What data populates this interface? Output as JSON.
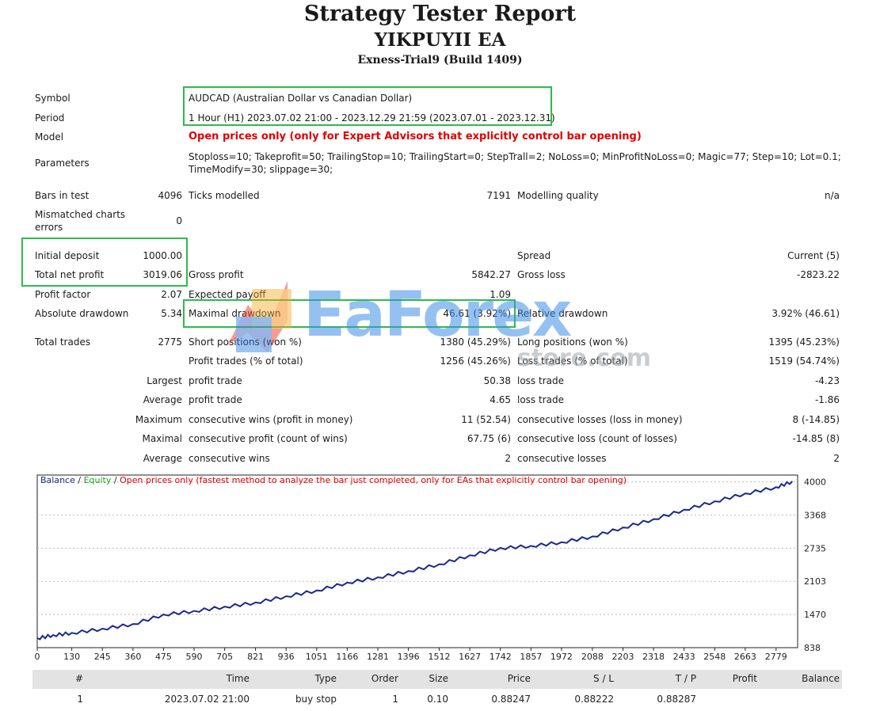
{
  "header": {
    "title": "Strategy Tester Report",
    "ea_name": "YIKPUYII EA",
    "server": "Exness-Trial9 (Build 1409)"
  },
  "settings": {
    "symbol_label": "Symbol",
    "symbol_value": "AUDCAD (Australian Dollar vs Canadian Dollar)",
    "period_label": "Period",
    "period_value": "1 Hour (H1) 2023.07.02 21:00 - 2023.12.29 21:59 (2023.07.01 - 2023.12.31)",
    "model_label": "Model",
    "model_value": "Open prices only (only for Expert Advisors that explicitly control bar opening)",
    "parameters_label": "Parameters",
    "parameters_line1": "Stoploss=10; Takeprofit=50; TrailingStop=10; TrailingStart=0; StepTrall=2; NoLoss=0; MinProfitNoLoss=0; Magic=77; Step=10; Lot=0.1;",
    "parameters_line2": "TimeModify=30; slippage=30;"
  },
  "stats": {
    "bars_label": "Bars in test",
    "bars_value": "4096",
    "ticks_label": "Ticks modelled",
    "ticks_value": "7191",
    "quality_label": "Modelling quality",
    "quality_value": "n/a",
    "mismatch_label1": "Mismatched charts",
    "mismatch_label2": "errors",
    "mismatch_value": "0",
    "initial_label": "Initial deposit",
    "initial_value": "1000.00",
    "spread_label": "Spread",
    "spread_value": "Current (5)",
    "netprofit_label": "Total net profit",
    "netprofit_value": "3019.06",
    "grossprofit_label": "Gross profit",
    "grossprofit_value": "5842.27",
    "grossloss_label": "Gross loss",
    "grossloss_value": "-2823.22",
    "pf_label": "Profit factor",
    "pf_value": "2.07",
    "expected_label": "Expected payoff",
    "expected_value": "1.09",
    "absdd_label": "Absolute drawdown",
    "absdd_value": "5.34",
    "maxdd_label": "Maximal drawdown",
    "maxdd_value": "46.61 (3.92%)",
    "reldd_label": "Relative drawdown",
    "reldd_value": "3.92% (46.61)",
    "total_label": "Total trades",
    "total_value": "2775",
    "short_label": "Short positions (won %)",
    "short_value": "1380 (45.29%)",
    "long_label": "Long positions (won %)",
    "long_value": "1395 (45.23%)",
    "ptrades_label": "Profit trades (% of total)",
    "ptrades_value": "1256 (45.26%)",
    "ltrades_label": "Loss trades (% of total)",
    "ltrades_value": "1519 (54.74%)",
    "largest_label": "Largest",
    "largest_p_label": "profit trade",
    "largest_p_value": "50.38",
    "largest_l_label": "loss trade",
    "largest_l_value": "-4.23",
    "average_label": "Average",
    "average_p_label": "profit trade",
    "average_p_value": "4.65",
    "average_l_label": "loss trade",
    "average_l_value": "-1.86",
    "maximum_label": "Maximum",
    "maximum_w_label": "consecutive wins (profit in money)",
    "maximum_w_value": "11 (52.54)",
    "maximum_l_label": "consecutive losses (loss in money)",
    "maximum_l_value": "8 (-14.85)",
    "maximal_label": "Maximal",
    "maximal_w_label": "consecutive profit (count of wins)",
    "maximal_w_value": "67.75 (6)",
    "maximal_l_label": "consecutive loss (count of losses)",
    "maximal_l_value": "-14.85 (8)",
    "avg2_label": "Average",
    "avg2_w_label": "consecutive wins",
    "avg2_w_value": "2",
    "avg2_l_label": "consecutive losses",
    "avg2_l_value": "2"
  },
  "watermark": {
    "text": "EaForex",
    "subtext": "store.com"
  },
  "chart_data": {
    "type": "line",
    "legend": {
      "balance": "Balance",
      "sep1": " / ",
      "equity": "Equity",
      "sep2": " / ",
      "note": "Open prices only (fastest method to analyze the bar just completed, only for EAs that explicitly control bar opening)"
    },
    "x_ticks": [
      0,
      130,
      245,
      360,
      475,
      590,
      705,
      821,
      936,
      1051,
      1166,
      1281,
      1396,
      1512,
      1627,
      1742,
      1857,
      1972,
      2088,
      2203,
      2318,
      2433,
      2548,
      2663,
      2779
    ],
    "y_ticks": [
      838,
      1470,
      2103,
      2735,
      3368,
      4000
    ],
    "xlim": [
      0,
      2860
    ],
    "ylim": [
      838,
      4130
    ],
    "series": [
      {
        "name": "Balance",
        "color": "#1a2a8c",
        "x": [
          0,
          60,
          130,
          245,
          360,
          475,
          590,
          705,
          821,
          936,
          1051,
          1166,
          1281,
          1396,
          1512,
          1627,
          1742,
          1857,
          1972,
          2088,
          2203,
          2318,
          2433,
          2548,
          2663,
          2779,
          2840
        ],
        "y": [
          1020,
          1080,
          1120,
          1200,
          1290,
          1470,
          1540,
          1620,
          1700,
          1820,
          1930,
          2080,
          2180,
          2300,
          2430,
          2600,
          2740,
          2780,
          2850,
          2960,
          3130,
          3290,
          3470,
          3630,
          3780,
          3900,
          4010
        ]
      }
    ]
  },
  "table": {
    "headers": [
      "#",
      "Time",
      "Type",
      "Order",
      "Size",
      "Price",
      "S / L",
      "T / P",
      "Profit",
      "Balance"
    ],
    "row": [
      "1",
      "2023.07.02 21:00",
      "buy stop",
      "1",
      "0.10",
      "0.88247",
      "0.88222",
      "0.88287",
      "",
      ""
    ]
  }
}
